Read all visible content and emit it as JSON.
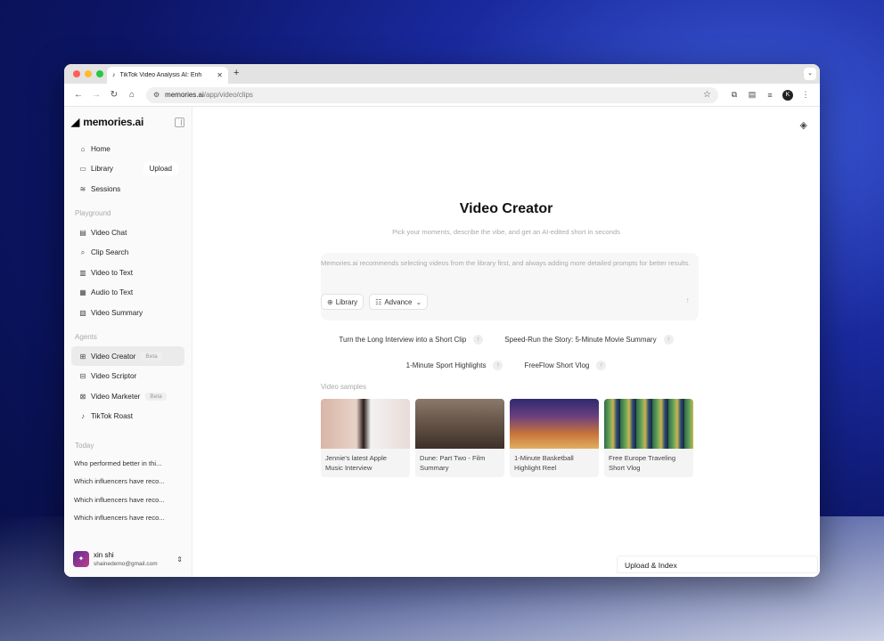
{
  "browser": {
    "tab_title": "TikTok Video Analysis AI: Enh",
    "tab_icon": "tiktok-icon",
    "new_tab": "+",
    "url_host": "memories.ai",
    "url_path": "/app/video/clips",
    "traffic_colors": [
      "#ff5f57",
      "#febc2e",
      "#28c840"
    ],
    "profile_initial": "K"
  },
  "sidebar": {
    "brand": "memories.ai",
    "nav": [
      {
        "label": "Home",
        "icon": "home-icon"
      },
      {
        "label": "Library",
        "icon": "library-icon",
        "action": "Upload"
      },
      {
        "label": "Sessions",
        "icon": "sessions-icon"
      }
    ],
    "playground_label": "Playground",
    "playground": [
      {
        "label": "Video Chat",
        "icon": "chat-icon"
      },
      {
        "label": "Clip Search",
        "icon": "search-icon"
      },
      {
        "label": "Video to Text",
        "icon": "video-text-icon"
      },
      {
        "label": "Audio to Text",
        "icon": "audio-text-icon"
      },
      {
        "label": "Video Summary",
        "icon": "summary-icon"
      }
    ],
    "agents_label": "Agents",
    "agents": [
      {
        "label": "Video Creator",
        "icon": "creator-icon",
        "badge": "Beta"
      },
      {
        "label": "Video Scriptor",
        "icon": "scriptor-icon"
      },
      {
        "label": "Video Marketer",
        "icon": "marketer-icon",
        "badge": "Beta"
      },
      {
        "label": "TikTok Roast",
        "icon": "roast-icon"
      }
    ],
    "today_label": "Today",
    "history": [
      "Who performed better in thi...",
      "Which influencers have reco...",
      "Which influencers have reco...",
      "Which influencers have reco..."
    ],
    "user": {
      "name": "xin shi",
      "email": "shainedemo@gmail.com"
    }
  },
  "main": {
    "title": "Video Creator",
    "subtitle": "Pick your moments, describe the vibe, and get an AI-edited short in seconds",
    "prompt_placeholder": "Memories.ai recommends selecting videos from the library first, and always adding more detailed prompts for better results.",
    "library_button": "Library",
    "advance_button": "Advance",
    "suggestions_row1": [
      "Turn the Long Interview into a Short Clip",
      "Speed-Run the Story: 5-Minute Movie Summary"
    ],
    "suggestions_row2": [
      "1-Minute Sport Highlights",
      "FreeFlow Short Vlog"
    ],
    "samples_label": "Video samples",
    "samples": [
      {
        "title": "Jennie's latest Apple Music Interview"
      },
      {
        "title": "Dune: Part Two - Film Summary"
      },
      {
        "title": "1-Minute Basketball Highlight Reel"
      },
      {
        "title": "Free Europe Traveling Short Vlog"
      }
    ],
    "upload_index": "Upload & Index"
  }
}
